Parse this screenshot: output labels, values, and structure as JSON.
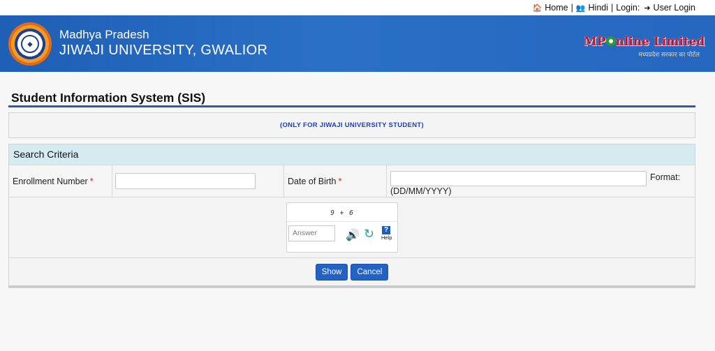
{
  "topbar": {
    "home": "Home",
    "hindi": "Hindi",
    "login_label": "Login:",
    "user_login": "User Login",
    "sep": "|"
  },
  "header": {
    "state": "Madhya Pradesh",
    "university": "JIWAJI UNIVERSITY, GWALIOR",
    "partner_brand_left": "MP",
    "partner_brand_right": "nline Limited",
    "partner_tagline": "मध्यप्रदेश सरकार का पोर्टल"
  },
  "page": {
    "title": "Student Information System (SIS)",
    "notice": "(ONLY FOR JIWAJI UNIVERSITY STUDENT)"
  },
  "search": {
    "heading": "Search Criteria",
    "enrollment_label": "Enrollment Number",
    "dob_label": "Date of Birth",
    "required_mark": "*",
    "format_label": "Format:",
    "format_value": "(DD/MM/YYYY)",
    "enrollment_value": "",
    "dob_value": ""
  },
  "captcha": {
    "question": "9 + 6",
    "answer_placeholder": "Answer",
    "help_label": "Help",
    "help_glyph": "?"
  },
  "buttons": {
    "show": "Show",
    "cancel": "Cancel"
  },
  "colors": {
    "banner": "#2667c0",
    "accent": "#2361c3",
    "required": "#d41b1b",
    "notice_text": "#1a3fc4"
  }
}
